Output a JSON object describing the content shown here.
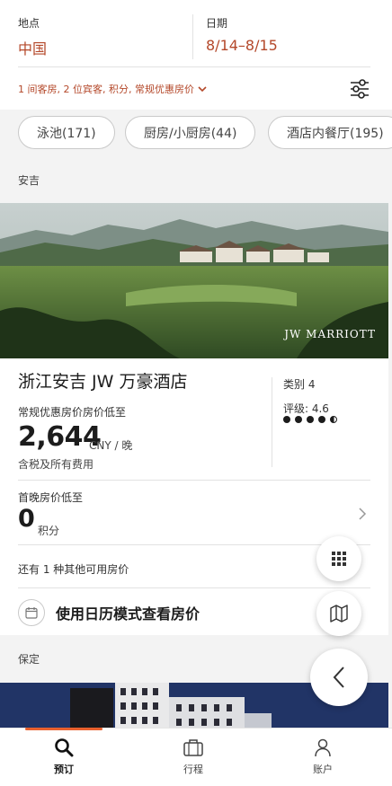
{
  "search": {
    "location_label": "地点",
    "location_value": "中国",
    "date_label": "日期",
    "date_value": "8/14–8/15",
    "guest_summary": "1 间客房, 2 位宾客, 积分, 常规优惠房价",
    "filter_icon": "sliders-icon"
  },
  "filters": {
    "chips": [
      "泳池(171)",
      "厨房/小厨房(44)",
      "酒店内餐厅(195)"
    ]
  },
  "sections": [
    {
      "region": "安吉",
      "hotel": {
        "name": "浙江安吉 JW 万豪酒店",
        "brand_logo": "JW MARRIOTT",
        "category": "类别 4",
        "rating": "评级: 4.6",
        "rating_value": 4.6,
        "regular_rate_label": "常规优惠房价房价低至",
        "price": "2,644",
        "price_unit": "CNY / 晚",
        "tax_note": "含税及所有费用",
        "first_night_label": "首晚房价低至",
        "points_value": "0",
        "points_unit": "积分",
        "other_rates": "还有 1 种其他可用房价",
        "calendar_button": "使用日历模式查看房价"
      }
    },
    {
      "region": "保定"
    }
  ],
  "fabs": [
    "grid-icon",
    "map-icon",
    "chevron-left-icon"
  ],
  "tabbar": {
    "tabs": [
      {
        "label": "预订",
        "icon": "search-icon",
        "active": true
      },
      {
        "label": "行程",
        "icon": "suitcase-icon",
        "active": false
      },
      {
        "label": "账户",
        "icon": "person-icon",
        "active": false
      }
    ]
  },
  "colors": {
    "accent": "#b4482a",
    "tab_indicator": "#e8602e"
  }
}
